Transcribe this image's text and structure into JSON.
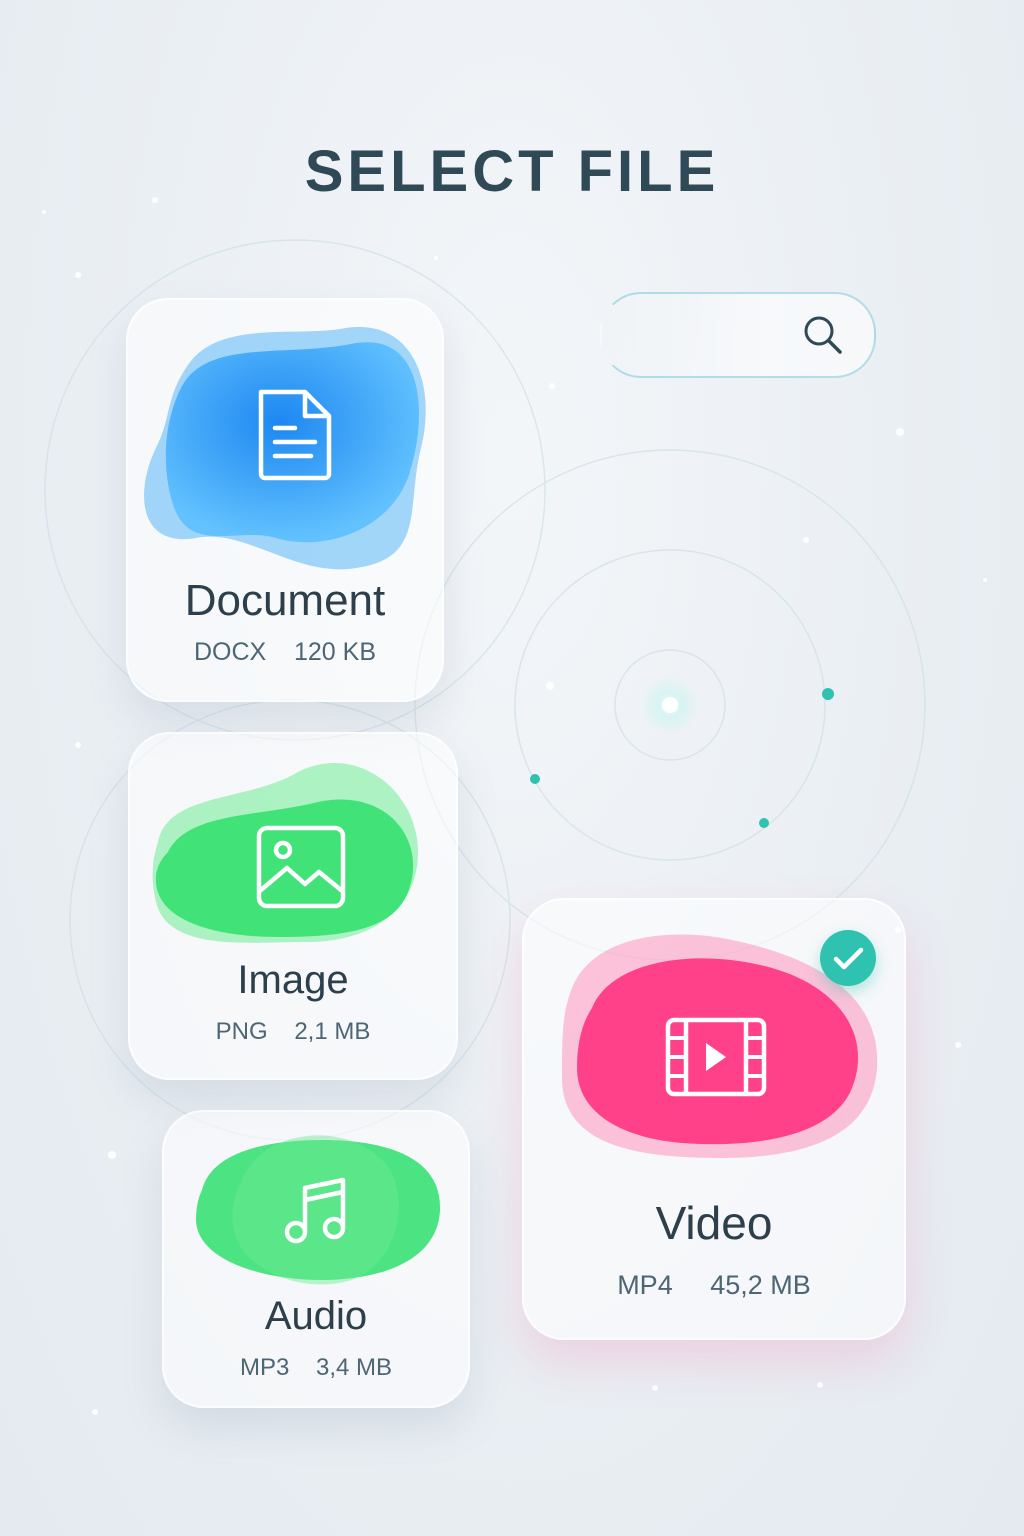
{
  "title": "SELECT FILE",
  "colors": {
    "document": "#1a8ff5",
    "image": "#2ee06c",
    "audio": "#2ee06c",
    "video": "#ff2f7d",
    "check": "#2fc2b0",
    "title": "#2f4a56"
  },
  "search": {
    "icon": "search-icon"
  },
  "files": {
    "document": {
      "name": "Document",
      "type": "DOCX",
      "size": "120 KB",
      "icon": "document-icon",
      "selected": false
    },
    "image": {
      "name": "Image",
      "type": "PNG",
      "size": "2,1 MB",
      "icon": "image-icon",
      "selected": false
    },
    "audio": {
      "name": "Audio",
      "type": "MP3",
      "size": "3,4 MB",
      "icon": "music-note-icon",
      "selected": false
    },
    "video": {
      "name": "Video",
      "type": "MP4",
      "size": "45,2 MB",
      "icon": "film-play-icon",
      "selected": true
    }
  }
}
